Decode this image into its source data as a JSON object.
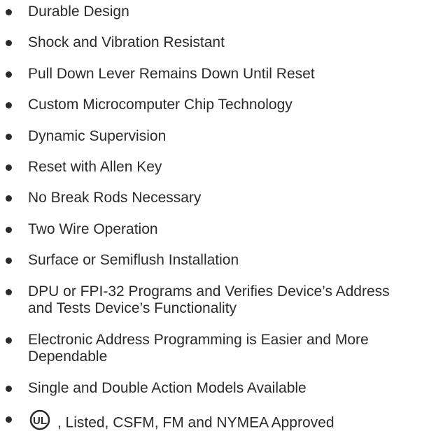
{
  "features": [
    "Durable Design",
    "Shock and Vibration Resistant",
    "Pull Down Lever Remains Down Until Reset",
    "Custom Microcomputer Chip Technology",
    "Dynamic Supervision",
    "Reset with Allen Key",
    "No Break Rods Necessary",
    "Two Wire Operation",
    "Surface or Semiflush Installation",
    "DPU or FPI-32 Programs and Verifies Device’s Address and Tests Device’s Functionality",
    "Electronic Address Programming is Easier and More Dependable",
    "Single and Double Action Models Available"
  ],
  "approvals": {
    "ul_logo_text": "UL",
    "text": ", Listed, CSFM, FM and NYMEA Approved"
  }
}
